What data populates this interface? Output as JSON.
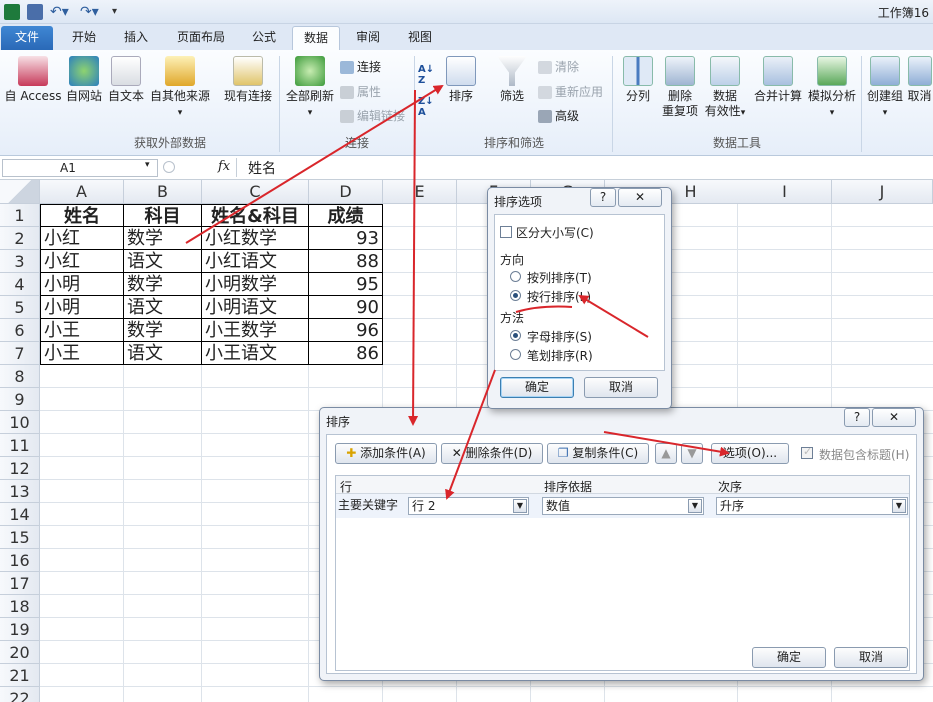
{
  "window": {
    "title": "工作簿16"
  },
  "tabs": [
    {
      "label": "文件"
    },
    {
      "label": "开始"
    },
    {
      "label": "插入"
    },
    {
      "label": "页面布局"
    },
    {
      "label": "公式"
    },
    {
      "label": "数据"
    },
    {
      "label": "审阅"
    },
    {
      "label": "视图"
    }
  ],
  "ribbon": {
    "access": "自 Access",
    "web": "自网站",
    "text": "自文本",
    "other_line1": "自其他来源",
    "existing": "现有连接",
    "refresh_all": "全部刷新",
    "connections": "连接",
    "properties": "属性",
    "edit_links": "编辑链接",
    "sort": "排序",
    "filter": "筛选",
    "clear": "清除",
    "reapply": "重新应用",
    "advanced": "高级",
    "split": "分列",
    "remove_dup_l1": "删除",
    "remove_dup_l2": "重复项",
    "validation_l1": "数据",
    "validation_l2": "有效性",
    "consolidate": "合并计算",
    "whatif": "模拟分析",
    "group": "创建组",
    "ungroup": "取消",
    "group_external": "获取外部数据",
    "group_conn": "连接",
    "group_sort": "排序和筛选",
    "group_tools": "数据工具"
  },
  "formula_bar": {
    "name_box": "A1",
    "fx": "fx",
    "value": "姓名"
  },
  "sheet": {
    "columns": [
      "A",
      "B",
      "C",
      "D",
      "E",
      "F",
      "G",
      "H",
      "I",
      "J"
    ],
    "rows": [
      "1",
      "2",
      "3",
      "4",
      "5",
      "6",
      "7",
      "8",
      "9",
      "10",
      "11",
      "12",
      "13",
      "14",
      "15",
      "16",
      "17",
      "18",
      "19",
      "20",
      "21",
      "22"
    ],
    "cells": [
      [
        "姓名",
        "科目",
        "姓名&科目",
        "成绩"
      ],
      [
        "小红",
        "数学",
        "小红数学",
        "93"
      ],
      [
        "小红",
        "语文",
        "小红语文",
        "88"
      ],
      [
        "小明",
        "数学",
        "小明数学",
        "95"
      ],
      [
        "小明",
        "语文",
        "小明语文",
        "90"
      ],
      [
        "小王",
        "数学",
        "小王数学",
        "96"
      ],
      [
        "小王",
        "语文",
        "小王语文",
        "86"
      ]
    ]
  },
  "sort_options_dialog": {
    "title": "排序选项",
    "help": "?",
    "close": "✕",
    "case_sensitive": "区分大小写(C)",
    "orientation_label": "方向",
    "by_column": "按列排序(T)",
    "by_row": "按行排序(L)",
    "method_label": "方法",
    "alphabetic": "字母排序(S)",
    "stroke": "笔划排序(R)",
    "ok": "确定",
    "cancel": "取消"
  },
  "sort_dialog": {
    "title": "排序",
    "help": "?",
    "close": "✕",
    "add_level": "添加条件(A)",
    "delete_level": "删除条件(D)",
    "copy_level": "复制条件(C)",
    "options": "选项(O)...",
    "has_headers": "数据包含标题(H)",
    "col_row": "行",
    "col_sorton": "排序依据",
    "col_order": "次序",
    "primary_key": "主要关键字",
    "key_value": "行 2",
    "sorton_value": "数值",
    "order_value": "升序",
    "ok": "确定",
    "cancel": "取消"
  },
  "colors": {
    "accent": "#2a69b7",
    "arrow": "#d9262b"
  }
}
